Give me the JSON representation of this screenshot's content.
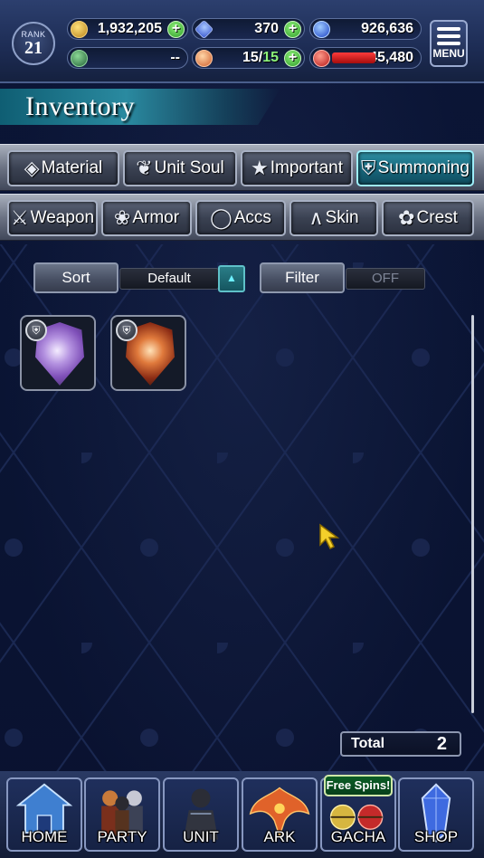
{
  "status": {
    "rank_label": "RANK",
    "rank_value": "21",
    "gil": "1,932,205",
    "visiore": "370",
    "lapis": "926,636",
    "hp": "45,480",
    "guild_value": "--",
    "stamina_current": "15",
    "stamina_sep": "/",
    "stamina_max": "15",
    "menu_label": "MENU"
  },
  "header": {
    "title": "Inventory"
  },
  "tabs_row1": [
    {
      "label": "Material",
      "icon": "bag-icon",
      "active": false
    },
    {
      "label": "Unit Soul",
      "icon": "soul-icon",
      "active": false
    },
    {
      "label": "Important",
      "icon": "star-icon",
      "active": false
    },
    {
      "label": "Summoning",
      "icon": "summon-shield-icon",
      "active": true
    }
  ],
  "tabs_row2": [
    {
      "label": "Weapon",
      "icon": "sword-icon"
    },
    {
      "label": "Armor",
      "icon": "armor-icon"
    },
    {
      "label": "Accs",
      "icon": "necklace-icon"
    },
    {
      "label": "Skin",
      "icon": "hanger-icon"
    },
    {
      "label": "Crest",
      "icon": "crest-icon"
    }
  ],
  "controls": {
    "sort_label": "Sort",
    "sort_value": "Default",
    "filter_label": "Filter",
    "filter_value": "OFF"
  },
  "items": [
    {
      "name": "summon-stone-purple",
      "colors": [
        "#e7d7ff",
        "#8a62c9",
        "#c07ad6"
      ]
    },
    {
      "name": "summon-stone-fire",
      "colors": [
        "#f3b58a",
        "#8a2b14",
        "#d0582a"
      ]
    }
  ],
  "total": {
    "label": "Total",
    "value": "2"
  },
  "nav": [
    {
      "label": "HOME"
    },
    {
      "label": "PARTY"
    },
    {
      "label": "UNIT"
    },
    {
      "label": "ARK"
    },
    {
      "label": "GACHA"
    },
    {
      "label": "SHOP"
    }
  ],
  "gacha_badge": "Free Spins!",
  "colors": {
    "active_tab": "#1e7386",
    "accent_cyan": "#6ef0ff",
    "background": "#0a1330"
  }
}
